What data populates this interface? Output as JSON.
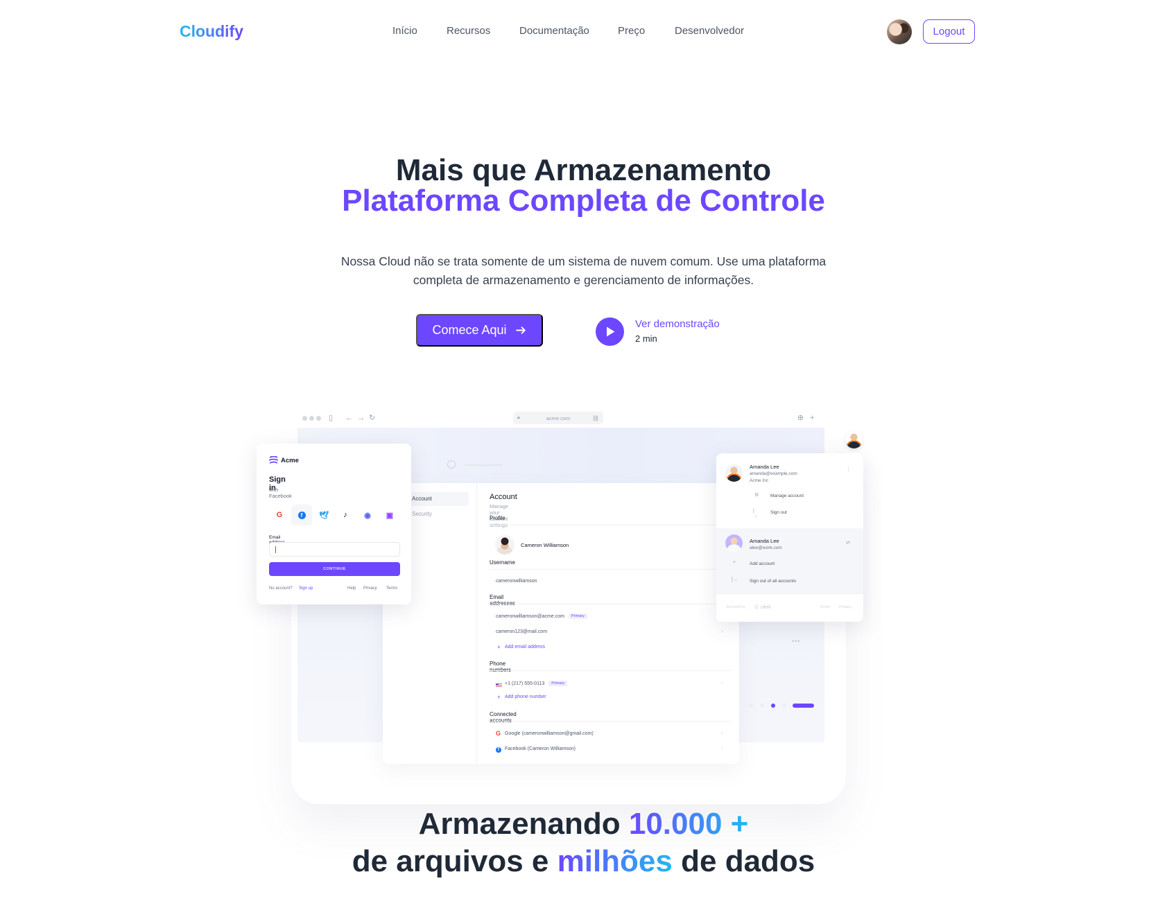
{
  "header": {
    "logo": "Cloudify",
    "nav": [
      {
        "label": "Início"
      },
      {
        "label": "Recursos"
      },
      {
        "label": "Documentação"
      },
      {
        "label": "Preço"
      },
      {
        "label": "Desenvolvedor"
      }
    ],
    "logout_label": "Logout"
  },
  "hero": {
    "title_line1": "Mais que Armazenamento",
    "title_line2": "Plataforma Completa de Controle",
    "description_line1": "Nossa Cloud não se trata somente de um sistema de nuvem comum. Use uma plataforma",
    "description_line2": "completa de armazenamento e gerenciamento de informações.",
    "cta_label": "Comece Aqui",
    "demo_label": "Ver demonstração",
    "demo_duration": "2 min"
  },
  "mockup": {
    "url": "acme.com",
    "signin": {
      "brand": "Acme",
      "title": "Sign in",
      "subtitle": "with Facebook",
      "providers": [
        "google",
        "facebook",
        "twitter",
        "tiktok",
        "discord",
        "twitch"
      ],
      "email_label": "Email address",
      "email_value": "",
      "continue_label": "CONTINUE",
      "no_account": "No account?",
      "sign_up": "Sign up",
      "help": "Help",
      "privacy": "Privacy",
      "terms": "Terms"
    },
    "account": {
      "sidebar": [
        "Account",
        "Security"
      ],
      "title": "Account",
      "subtitle": "Manage your account settings",
      "profile_label": "Profile",
      "profile_name": "Cameron Williamson",
      "username_label": "Username",
      "username": "cameronwilliamson",
      "email_label": "Email addresses",
      "emails": [
        {
          "value": "cameronwilliamson@acme.com",
          "badge": "Primary"
        },
        {
          "value": "cameron123@mail.com",
          "badge": ""
        }
      ],
      "add_email": "Add email address",
      "phone_label": "Phone numbers",
      "phone": "+1 (217) 555-0113",
      "phone_badge": "Primary",
      "add_phone": "Add phone number",
      "connected_label": "Connected accounts",
      "connected": [
        "Google (cameronwilliamson@gmail.com)",
        "Facebook (Cameron Williamson)"
      ]
    },
    "user_menu": {
      "primary": {
        "name": "Amanda Lee",
        "email": "amanda@example.com",
        "org": "Acme Inc"
      },
      "manage": "Manage account",
      "sign_out": "Sign out",
      "secondary": {
        "name": "Amanda Lee",
        "email": "alee@work.com"
      },
      "add_account": "Add account",
      "sign_out_all": "Sign out of all accounts",
      "secured_by": "Secured by",
      "clerk": "clerk",
      "terms": "Terms",
      "privacy": "Privacy"
    },
    "carousel": {
      "total": 5,
      "active": 3
    }
  },
  "stats": {
    "line1_prefix": "Armazenando",
    "line1_highlight": "10.000 +",
    "line2_prefix": "de arquivos e",
    "line2_highlight": "milhões",
    "line2_suffix": "de dados"
  },
  "colors": {
    "brand": "#6c47ff",
    "accent": "#22b8f0",
    "text": "#1f2937"
  }
}
